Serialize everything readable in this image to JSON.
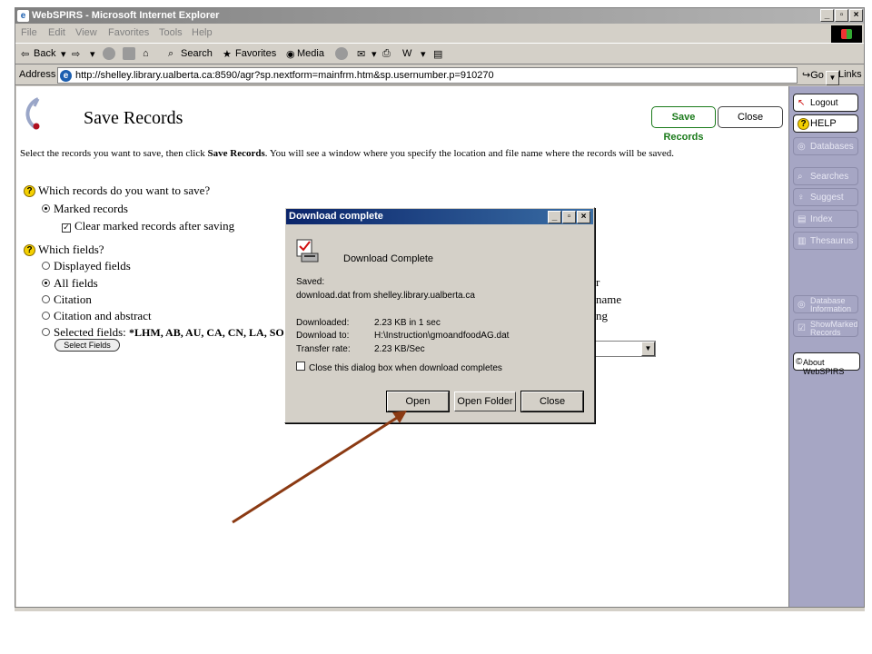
{
  "window": {
    "title": "WebSPIRS - Microsoft Internet Explorer",
    "menu": [
      "File",
      "Edit",
      "View",
      "Favorites",
      "Tools",
      "Help"
    ],
    "toolbar": {
      "back": "Back",
      "search": "Search",
      "favorites": "Favorites",
      "media": "Media"
    },
    "address": {
      "label": "Address",
      "url": "http://shelley.library.ualberta.ca:8590/agr?sp.nextform=mainfrm.htm&sp.usernumber.p=910270",
      "go": "Go",
      "links": "Links"
    }
  },
  "page": {
    "title": "Save Records",
    "save_button": "Save Records",
    "close_button": "Close",
    "instructions_pre": "Select the records you want to save, then click ",
    "instructions_bold": "Save Records",
    "instructions_post": ". You will see a window where you specify the location and file name where the records will be saved.",
    "q1": "Which records do you want to save?",
    "marked_records": "Marked records",
    "clear_marked": "Clear marked records after saving",
    "q2": "Which fields?",
    "displayed_fields": "Displayed fields",
    "all_fields": "All fields",
    "citation": "Citation",
    "citation_abstract": "Citation and abstract",
    "selected_fields": "Selected fields: ",
    "selected_fields_list": "*LHM, AB, AU, CA, CN, LA, SO,",
    "select_fields_button": "Select Fields",
    "partial_right": [
      "r",
      "name",
      "ng"
    ]
  },
  "sidebar": {
    "items": [
      {
        "label": "Logout",
        "icon": "logout-icon",
        "glyph": "↖"
      },
      {
        "label": "HELP",
        "icon": "help-icon",
        "glyph": "?"
      },
      {
        "label": "Databases",
        "icon": "databases-icon",
        "glyph": "◎"
      },
      {
        "label": "Searches",
        "icon": "searches-icon",
        "glyph": "⌕"
      },
      {
        "label": "Suggest",
        "icon": "suggest-icon",
        "glyph": "♀"
      },
      {
        "label": "Index",
        "icon": "index-icon",
        "glyph": "▤"
      },
      {
        "label": "Thesaurus",
        "icon": "thesaurus-icon",
        "glyph": "▥"
      },
      {
        "label1": "Database",
        "label2": "Information",
        "icon": "database-info-icon",
        "glyph": "◎"
      },
      {
        "label1": "ShowMarked",
        "label2": "Records",
        "icon": "show-marked-icon",
        "glyph": "☑"
      },
      {
        "label": "About WebSPIRS",
        "icon": "about-icon",
        "glyph": "©"
      }
    ]
  },
  "dialog": {
    "title": "Download complete",
    "heading": "Download Complete",
    "saved_label": "Saved:",
    "saved_value": "download.dat from shelley.library.ualberta.ca",
    "downloaded_label": "Downloaded:",
    "downloaded_value": "2.23 KB in 1 sec",
    "download_to_label": "Download to:",
    "download_to_value": "H:\\Instruction\\gmoandfoodAG.dat",
    "transfer_rate_label": "Transfer rate:",
    "transfer_rate_value": "2.23 KB/Sec",
    "close_when_done": "Close this dialog box when download completes",
    "open_button": "Open",
    "open_folder_button": "Open Folder",
    "close_button": "Close"
  },
  "colors": {
    "dialog_title": "#0a246a",
    "save_button_text": "#1a7a1a",
    "sidebar_bg": "#a6a6c4",
    "arrow": "#8b3a13"
  }
}
